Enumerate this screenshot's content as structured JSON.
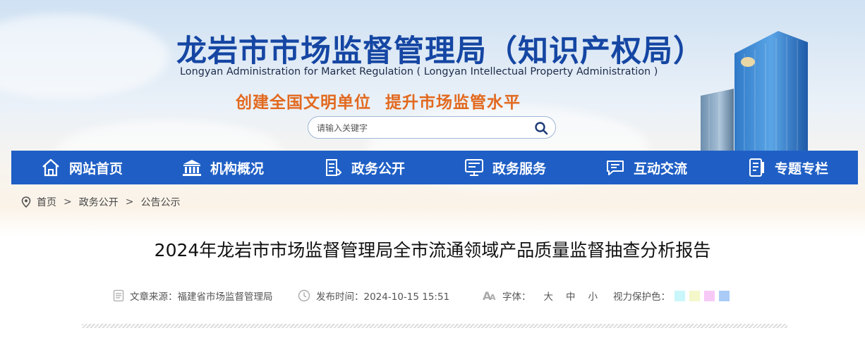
{
  "header": {
    "title": "龙岩市市场监督管理局（知识产权局）",
    "subtitle": "Longyan Administration for Market Regulation ( Longyan Intellectual Property Administration )",
    "slogan_left": "创建全国文明单位",
    "slogan_right": "提升市场监管水平",
    "search": {
      "placeholder": "请输入关键字",
      "icon": "search-icon"
    }
  },
  "nav": {
    "items": [
      {
        "label": "网站首页",
        "icon": "home-icon"
      },
      {
        "label": "机构概况",
        "icon": "institution-icon"
      },
      {
        "label": "政务公开",
        "icon": "document-icon"
      },
      {
        "label": "政务服务",
        "icon": "service-icon"
      },
      {
        "label": "互动交流",
        "icon": "chat-icon"
      },
      {
        "label": "专题专栏",
        "icon": "topic-icon"
      }
    ]
  },
  "breadcrumb": {
    "icon": "location-icon",
    "items": [
      "首页",
      "政务公开",
      "公告公示"
    ],
    "separator": ">"
  },
  "article": {
    "title": "2024年龙岩市市场监督管理局全市流通领域产品质量监督抽查分析报告",
    "source": "文章来源：福建省市场监督管理局",
    "time": "发布时间：2024-10-15 15:51",
    "font_label": "字体：",
    "font_large": "大",
    "font_medium": "中",
    "font_small": "小",
    "eye_label": "视力保护色：",
    "eye_colors": [
      "#c9f6fb",
      "#f4f7c9",
      "#f7c9f6",
      "#a9cbf5"
    ]
  },
  "colors": {
    "nav_bg": "#1f5fc5",
    "title_blue": "#1546a3",
    "slogan_orange": "#e2691f"
  }
}
